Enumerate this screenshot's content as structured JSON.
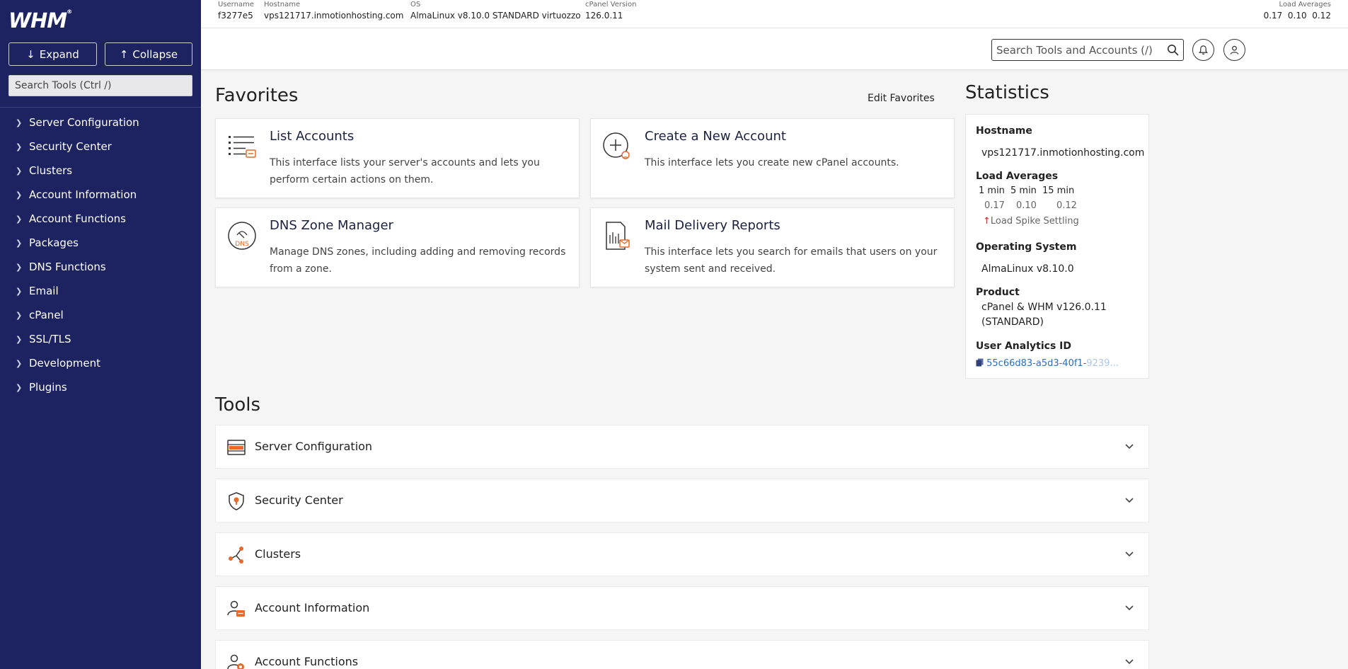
{
  "brand": {
    "logo_text": "WHM",
    "accent": "#e66a2c",
    "sidebar_bg": "#1c2360"
  },
  "sidebar": {
    "expand_label": "Expand",
    "collapse_label": "Collapse",
    "search_placeholder": "Search Tools (Ctrl /)",
    "items": [
      {
        "label": "Server Configuration"
      },
      {
        "label": "Security Center"
      },
      {
        "label": "Clusters"
      },
      {
        "label": "Account Information"
      },
      {
        "label": "Account Functions"
      },
      {
        "label": "Packages"
      },
      {
        "label": "DNS Functions"
      },
      {
        "label": "Email"
      },
      {
        "label": "cPanel"
      },
      {
        "label": "SSL/TLS"
      },
      {
        "label": "Development"
      },
      {
        "label": "Plugins"
      }
    ]
  },
  "infobar": {
    "username": {
      "label": "Username",
      "value": "f3277e5"
    },
    "hostname": {
      "label": "Hostname",
      "value": "vps121717.inmotionhosting.com"
    },
    "os": {
      "label": "OS",
      "value": "AlmaLinux v8.10.0 STANDARD virtuozzo"
    },
    "cpanel": {
      "label": "cPanel Version",
      "value": "126.0.11"
    },
    "load": {
      "label": "Load Averages",
      "value": "0.17  0.10  0.12"
    }
  },
  "header": {
    "search_placeholder": "Search Tools and Accounts (/)"
  },
  "favorites": {
    "title": "Favorites",
    "edit_label": "Edit Favorites",
    "cards": [
      {
        "title": "List Accounts",
        "desc": "This interface lists your server's accounts and lets you perform certain actions on them.",
        "icon": "list-accounts-icon"
      },
      {
        "title": "Create a New Account",
        "desc": "This interface lets you create new cPanel accounts.",
        "icon": "create-account-icon"
      },
      {
        "title": "DNS Zone Manager",
        "desc": "Manage DNS zones, including adding and removing records from a zone.",
        "icon": "dns-icon"
      },
      {
        "title": "Mail Delivery Reports",
        "desc": "This interface lets you search for emails that users on your system sent and received.",
        "icon": "mail-report-icon"
      }
    ]
  },
  "statistics": {
    "title": "Statistics",
    "hostname_label": "Hostname",
    "hostname_value": "vps121717.inmotionhosting.com",
    "load_label": "Load Averages",
    "load_headers": [
      "1 min",
      "5 min",
      "15 min"
    ],
    "load_values": [
      "0.17",
      "0.10",
      "0.12"
    ],
    "load_note": "Load Spike Settling",
    "os_label": "Operating System",
    "os_value": "AlmaLinux v8.10.0",
    "product_label": "Product",
    "product_value_1": "cPanel & WHM v126.0.11",
    "product_value_2": "(STANDARD)",
    "uaid_label": "User Analytics ID",
    "uaid_value": "55c66d83-a5d3-40f1-",
    "uaid_fade": "9239..."
  },
  "tools": {
    "title": "Tools",
    "rows": [
      {
        "label": "Server Configuration",
        "icon": "server-icon"
      },
      {
        "label": "Security Center",
        "icon": "shield-icon"
      },
      {
        "label": "Clusters",
        "icon": "cluster-icon"
      },
      {
        "label": "Account Information",
        "icon": "account-info-icon"
      },
      {
        "label": "Account Functions",
        "icon": "account-functions-icon"
      }
    ]
  }
}
